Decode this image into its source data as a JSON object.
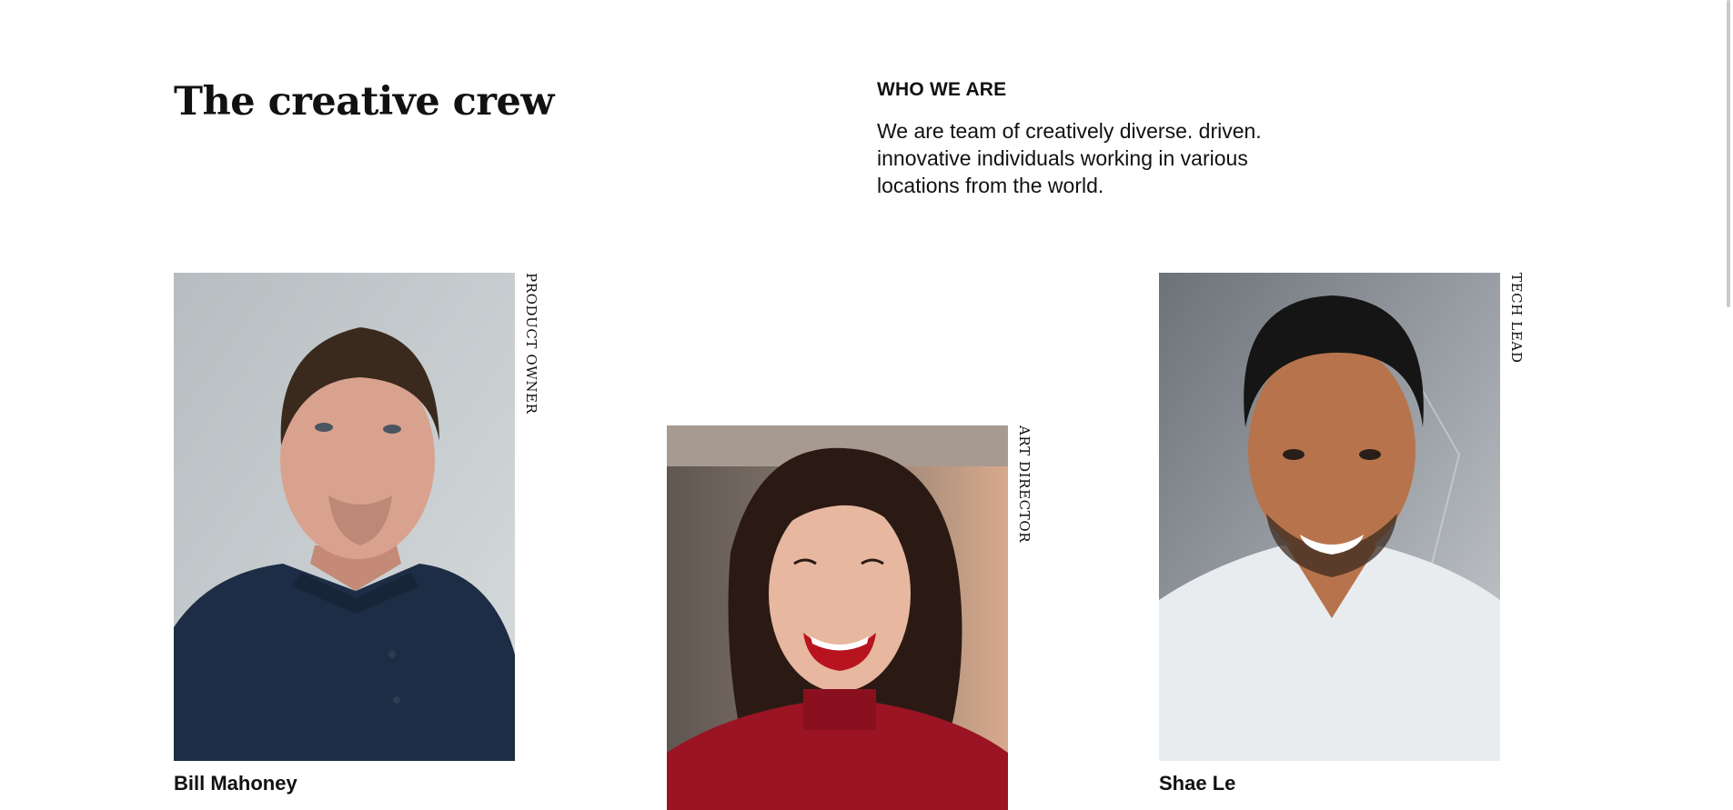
{
  "section": {
    "title": "The creative crew",
    "eyebrow": "WHO WE ARE",
    "description": "We are team of creatively diverse. driven. innovative individuals working in various locations from the world."
  },
  "members": [
    {
      "name": "Bill Mahoney",
      "role": "PRODUCT OWNER",
      "photo": "man-navy-polo-portrait-photo",
      "colors": {
        "background": "#bcc3c5",
        "shirt": "#1d2d45",
        "skin": "#d9a28e",
        "hair": "#3a2a1e"
      }
    },
    {
      "name": "",
      "role": "ART DIRECTOR",
      "photo": "smiling-woman-red-sweater-portrait-photo",
      "colors": {
        "background": "#6f665f",
        "shirt": "#9a1423",
        "skin": "#e7b7a0",
        "hair": "#2b1a14"
      }
    },
    {
      "name": "Shae Le",
      "role": "TECH LEAD",
      "photo": "man-white-tshirt-portrait-photo",
      "colors": {
        "background": "#8c9095",
        "shirt": "#e9ecef",
        "skin": "#b7744c",
        "hair": "#151515"
      }
    }
  ]
}
